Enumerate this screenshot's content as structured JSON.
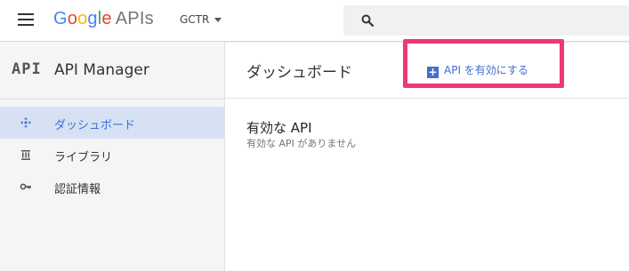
{
  "header": {
    "logo_google": "Google",
    "logo_apis": "APIs",
    "project": "GCTR",
    "colors": {
      "google_blue": "#4285F4",
      "google_red": "#EA4335",
      "google_yellow": "#FBBC05",
      "google_green": "#34A853"
    }
  },
  "sidebar": {
    "logo": "API",
    "title": "API Manager",
    "items": [
      {
        "label": "ダッシュボード",
        "icon": "dashboard-icon",
        "active": true
      },
      {
        "label": "ライブラリ",
        "icon": "library-icon",
        "active": false
      },
      {
        "label": "認証情報",
        "icon": "key-icon",
        "active": false
      }
    ]
  },
  "main": {
    "title": "ダッシュボード",
    "enable_button": "API を有効にする",
    "section_title": "有効な API",
    "section_subtitle": "有効な API がありません"
  },
  "colors": {
    "accent": "#3f6fd1",
    "highlight": "#f0357b",
    "active_bg": "#d6e1f4"
  }
}
